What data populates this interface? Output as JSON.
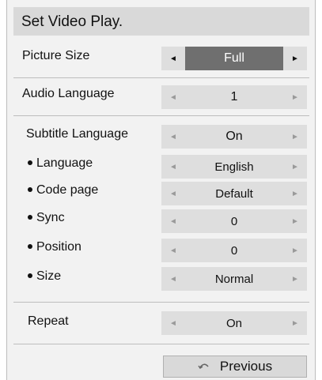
{
  "title": "Set Video Play.",
  "rows": {
    "picture_size": {
      "label": "Picture Size",
      "value": "Full"
    },
    "audio_language": {
      "label": "Audio Language",
      "value": "1"
    },
    "subtitle_language": {
      "label": "Subtitle Language",
      "value": "On"
    },
    "language": {
      "label": "Language",
      "value": "English"
    },
    "code_page": {
      "label": "Code page",
      "value": "Default"
    },
    "sync": {
      "label": "Sync",
      "value": "0"
    },
    "position": {
      "label": "Position",
      "value": "0"
    },
    "size": {
      "label": "Size",
      "value": "Normal"
    },
    "repeat": {
      "label": "Repeat",
      "value": "On"
    }
  },
  "arrows": {
    "left": "◄",
    "right": "►"
  },
  "previous_button": {
    "label": "Previous",
    "icon": "return-icon"
  },
  "colors": {
    "active_value_bg": "#6f6f6f",
    "panel_bg": "#f2f2f2",
    "selector_bg": "#dedede"
  }
}
